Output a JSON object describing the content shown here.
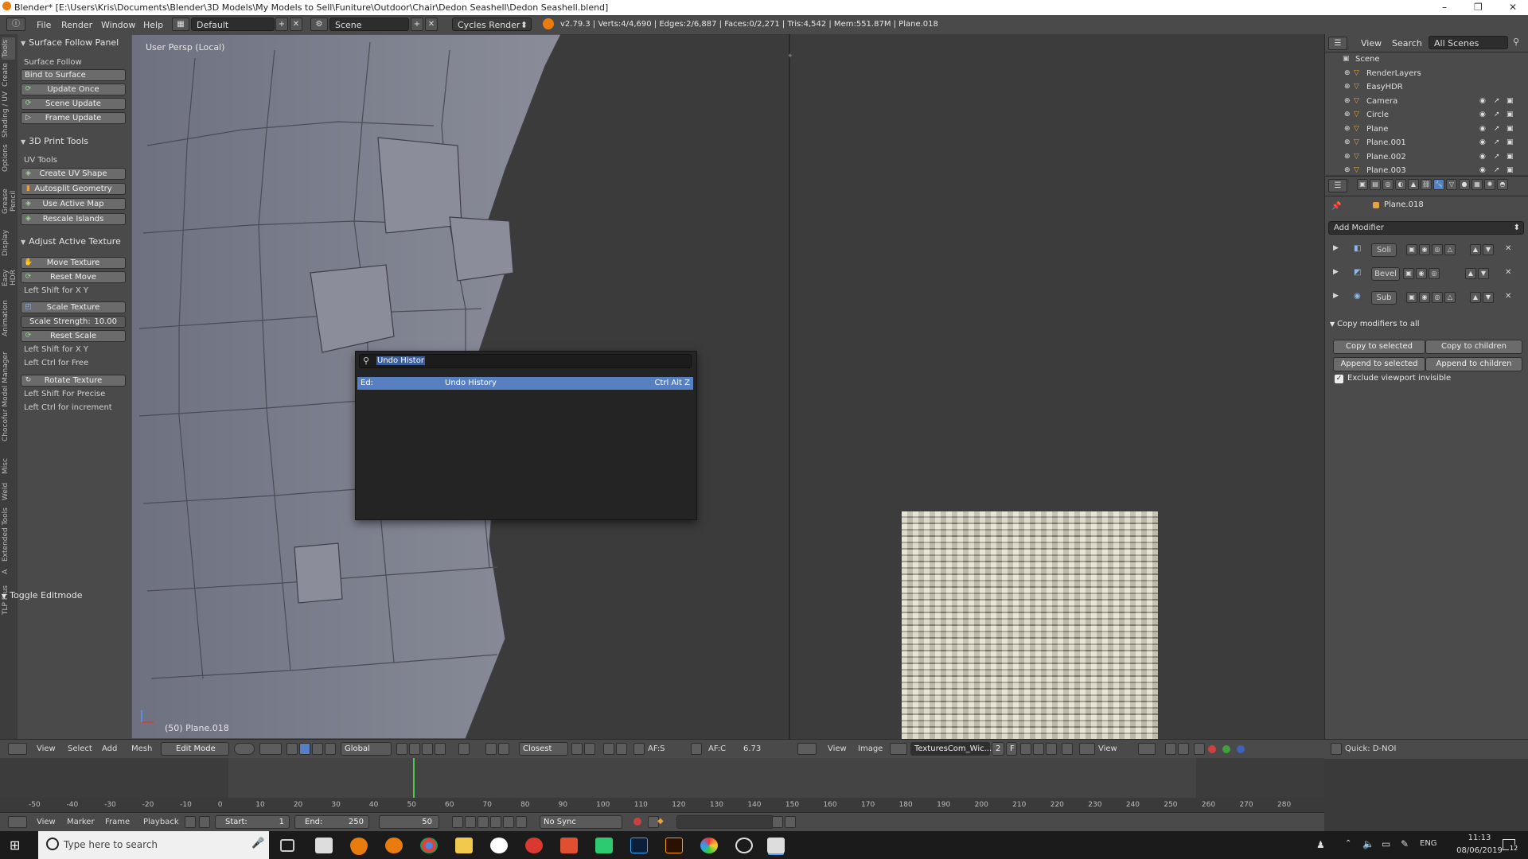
{
  "window": {
    "title": "Blender* [E:\\Users\\Kris\\Documents\\Blender\\3D Models\\My Models to Sell\\Funiture\\Outdoor\\Chair\\Dedon Seashell\\Dedon Seashell.blend]",
    "minimize": "–",
    "maximize": "❐",
    "close": "✕"
  },
  "info_header": {
    "menus": [
      "File",
      "Render",
      "Window",
      "Help"
    ],
    "layout": "Default",
    "scene": "Scene",
    "engine": "Cycles Render",
    "stats": "v2.79.3 | Verts:4/4,690 | Edges:2/6,887 | Faces:0/2,271 | Tris:4,542 | Mem:551.87M | Plane.018"
  },
  "tool_tabs": [
    "Tools",
    "Create",
    "Shading / UV",
    "Options",
    "Grease Pencil",
    "Display",
    "Easy HDR",
    "Animation",
    "Chocofur Model Manager",
    "Misc",
    "Weld",
    "Extended Tools",
    "A",
    "TLP Plus"
  ],
  "tool_shelf": {
    "surface_follow": {
      "header": "Surface Follow Panel",
      "label": "Surface Follow",
      "bind_label": "Bind to Surface",
      "buttons": [
        "Update Once",
        "Scene Update",
        "Frame Update"
      ]
    },
    "print_tools": {
      "header": "3D Print Tools",
      "label": "UV Tools",
      "buttons": [
        "Create UV Shape",
        "Autosplit Geometry",
        "Use Active Map",
        "Rescale Islands"
      ]
    },
    "adjust_texture": {
      "header": "Adjust Active Texture",
      "move_texture": "Move Texture",
      "reset_move": "Reset Move",
      "hint_move": "Left Shift for X Y",
      "scale_texture": "Scale Texture",
      "scale_strength_label": "Scale Strength:",
      "scale_strength_value": "10.00",
      "reset_scale": "Reset Scale",
      "hint_scale_1": "Left Shift for X Y",
      "hint_scale_2": "Left Ctrl for Free",
      "rotate_texture": "Rotate Texture",
      "hint_rotate_1": "Left Shift For Precise",
      "hint_rotate_2": "Left Ctrl for increment"
    },
    "toggle_editmode": "Toggle Editmode"
  },
  "viewport": {
    "perspective_label": "User Persp (Local)",
    "object_label": "(50) Plane.018"
  },
  "operator_search": {
    "query": "Undo Histor",
    "result_prefix": "Ed:",
    "result_name": "Undo History",
    "result_shortcut": "Ctrl Alt Z"
  },
  "outliner": {
    "header_menus": [
      "View",
      "Search"
    ],
    "scene_filter": "All Scenes",
    "items": [
      {
        "name": "Scene",
        "indent": 0
      },
      {
        "name": "RenderLayers",
        "indent": 1
      },
      {
        "name": "EasyHDR",
        "indent": 1
      },
      {
        "name": "Camera",
        "indent": 1
      },
      {
        "name": "Circle",
        "indent": 1
      },
      {
        "name": "Plane",
        "indent": 1
      },
      {
        "name": "Plane.001",
        "indent": 1
      },
      {
        "name": "Plane.002",
        "indent": 1
      },
      {
        "name": "Plane.003",
        "indent": 1
      }
    ]
  },
  "properties": {
    "object_name": "Plane.018",
    "add_modifier": "Add Modifier",
    "modifiers": [
      "Soli",
      "Bevel",
      "Sub"
    ],
    "copy_panel": "Copy modifiers to all",
    "copy_to_selected": "Copy to selected",
    "copy_to_children": "Copy to children",
    "append_to_selected": "Append to selected",
    "append_to_children": "Append to children",
    "exclude_invisible": "Exclude viewport invisible"
  },
  "viewport_footer": {
    "menus": [
      "View",
      "Select",
      "Add",
      "Mesh"
    ],
    "mode": "Edit Mode",
    "orientation": "Global",
    "snap": "Closest",
    "af_s": "AF:S",
    "af_c": "AF:C",
    "value": "6.73"
  },
  "image_footer": {
    "menus": [
      "View",
      "Image"
    ],
    "image_name": "TexturesCom_Wic...",
    "users": "2",
    "fake": "F",
    "view": "View",
    "quick": "Quick: D-NOI"
  },
  "timeline": {
    "ticks": [
      "-50",
      "-40",
      "-30",
      "-20",
      "-10",
      "0",
      "10",
      "20",
      "30",
      "40",
      "50",
      "60",
      "70",
      "80",
      "90",
      "100",
      "110",
      "120",
      "130",
      "140",
      "150",
      "160",
      "170",
      "180",
      "190",
      "200",
      "210",
      "220",
      "230",
      "240",
      "250",
      "260",
      "270",
      "280"
    ],
    "current_frame_fraction": 0.1667,
    "menus": [
      "View",
      "Marker",
      "Frame",
      "Playback"
    ],
    "start_label": "Start:",
    "start_value": "1",
    "end_label": "End:",
    "end_value": "250",
    "current": "50",
    "sync": "No Sync"
  },
  "taskbar": {
    "search_placeholder": "Type here to search",
    "lang": "ENG",
    "time": "11:13",
    "date": "08/06/2019",
    "notifications": "12"
  },
  "colors": {
    "selection": "#5680c2",
    "current_frame": "#4ec94e"
  }
}
